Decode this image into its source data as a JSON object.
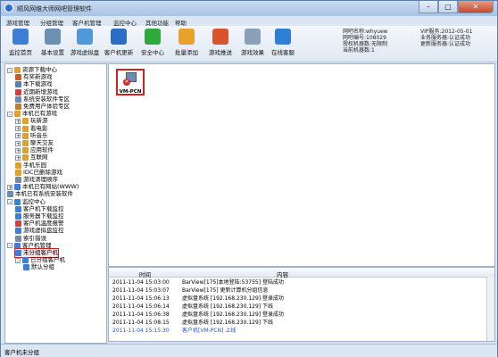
{
  "window": {
    "title": "顺风网维大师网吧管理软件"
  },
  "menu": [
    "游戏管理",
    "分组管理",
    "客户机管理",
    "监控中心",
    "其他功能",
    "帮助"
  ],
  "toolbar": [
    {
      "label": "监控首页",
      "icon": "monitor-icon",
      "color": "#3d7fd6"
    },
    {
      "label": "基本设置",
      "icon": "gear-icon",
      "color": "#6c8fb4"
    },
    {
      "label": "游戏虚拟盘",
      "icon": "disk-icon",
      "color": "#4f9ad6"
    },
    {
      "label": "客户机更新",
      "icon": "computer-update-icon",
      "color": "#2b6cc4"
    },
    {
      "label": "安全中心",
      "icon": "shield-icon",
      "color": "#2eaa3a"
    },
    {
      "label": "批量添加",
      "icon": "folder-icon",
      "color": "#e8a22a"
    },
    {
      "label": "游戏推送",
      "icon": "push-icon",
      "color": "#d9532c"
    },
    {
      "label": "游戏效果",
      "icon": "gamepad-icon",
      "color": "#8a9fb8"
    },
    {
      "label": "在线客服",
      "icon": "chat-icon",
      "color": "#2f7fd4"
    }
  ],
  "info": {
    "left": [
      "网吧名称:whyuew",
      "网吧编号:108029",
      "授权机器数:无限制",
      "当前机器数:1"
    ],
    "right": [
      "VIP服务:2012-05-01",
      "业务服务器:认证成功",
      "更新服务器:认证成功"
    ]
  },
  "tree": [
    {
      "label": "资源下载中心",
      "level": 0,
      "toggle": "-",
      "icon": "#e0a030"
    },
    {
      "label": "有奖新游戏",
      "level": 1,
      "toggle": "",
      "icon": "#c85a2a"
    },
    {
      "label": "本下载游戏",
      "level": 1,
      "toggle": "",
      "icon": "#5a7fb4"
    },
    {
      "label": "近期新增游戏",
      "level": 1,
      "toggle": "",
      "icon": "#d04040"
    },
    {
      "label": "系统安装软件专区",
      "level": 1,
      "toggle": "",
      "icon": "#6a8ab0"
    },
    {
      "label": "免费用户体验专区",
      "level": 1,
      "toggle": "",
      "icon": "#c08030"
    },
    {
      "label": "本机已有游戏",
      "level": 0,
      "toggle": "-",
      "icon": "#e0a030"
    },
    {
      "label": "玩新游",
      "level": 1,
      "toggle": "+",
      "icon": "#e0a030"
    },
    {
      "label": "看电影",
      "level": 1,
      "toggle": "+",
      "icon": "#e0a030"
    },
    {
      "label": "听音乐",
      "level": 1,
      "toggle": "+",
      "icon": "#e0a030"
    },
    {
      "label": "聊天交友",
      "level": 1,
      "toggle": "+",
      "icon": "#e0a030"
    },
    {
      "label": "应用软件",
      "level": 1,
      "toggle": "+",
      "icon": "#e0a030"
    },
    {
      "label": "互联网",
      "level": 1,
      "toggle": "+",
      "icon": "#e0a030"
    },
    {
      "label": "手机乐园",
      "level": 1,
      "toggle": "",
      "icon": "#e0a030"
    },
    {
      "label": "IDC已删除游戏",
      "level": 1,
      "toggle": "",
      "icon": "#e0a030"
    },
    {
      "label": "游戏清理顺序",
      "level": 1,
      "toggle": "",
      "icon": "#7a8aa0"
    },
    {
      "label": "本机已有网站(WWW)",
      "level": 0,
      "toggle": "+",
      "icon": "#3d7fd6"
    },
    {
      "label": "本机已有系统安装软件",
      "level": 0,
      "toggle": "",
      "icon": "#6a8ab0"
    },
    {
      "label": "监控中心",
      "level": 0,
      "toggle": "-",
      "icon": "#3d7fd6"
    },
    {
      "label": "客户机下载监控",
      "level": 1,
      "toggle": "",
      "icon": "#3d7fd6"
    },
    {
      "label": "服务器下载监控",
      "level": 1,
      "toggle": "",
      "icon": "#3d7fd6"
    },
    {
      "label": "客户机温度报警",
      "level": 1,
      "toggle": "",
      "icon": "#d04040"
    },
    {
      "label": "游戏虚拟盘监控",
      "level": 1,
      "toggle": "",
      "icon": "#3d7fd6"
    },
    {
      "label": "索引错误",
      "level": 1,
      "toggle": "",
      "icon": "#7a8aa0"
    },
    {
      "label": "客户机管理",
      "level": 0,
      "toggle": "-",
      "icon": "#3d7fd6"
    },
    {
      "label": "未分组客户机",
      "level": 1,
      "toggle": "",
      "icon": "#3d7fd6",
      "selected": true
    },
    {
      "label": "已分组客户机",
      "level": 1,
      "toggle": "-",
      "icon": "#3d7fd6"
    },
    {
      "label": "默认分组",
      "level": 2,
      "toggle": "",
      "icon": "#3d7fd6"
    }
  ],
  "clients": [
    {
      "name": "VM-PCN",
      "status": "offline"
    }
  ],
  "log": {
    "headers": [
      "时间",
      "内容"
    ],
    "rows": [
      {
        "time": "2011-11-04 15:03:00",
        "content": "BarView[175]本地登陆:53755] 登陆成功",
        "color": "#000000"
      },
      {
        "time": "2011-11-04 15:03:07",
        "content": "BarView[175] 更新计算机分组信息",
        "color": "#000000"
      },
      {
        "time": "2011-11-04 15:06:13",
        "content": "虚拟盘系统 [192.168.230.129] 登录成功",
        "color": "#000000"
      },
      {
        "time": "2011-11-04 15:06:14",
        "content": "虚拟盘系统 [192.168.230.129] 下线",
        "color": "#000000"
      },
      {
        "time": "2011-11-04 15:06:38",
        "content": "虚拟盘系统 [192.168.230.129] 登录成功",
        "color": "#000000"
      },
      {
        "time": "2011-11-04 15:08:15",
        "content": "虚拟盘系统 [192.168.230.129] 下线",
        "color": "#000000"
      },
      {
        "time": "2011-11-04 15:15:30",
        "content": "客户机[VM-PCN] 上线",
        "color": "#2255cc"
      }
    ]
  },
  "status": {
    "text": "客户机未分组"
  }
}
